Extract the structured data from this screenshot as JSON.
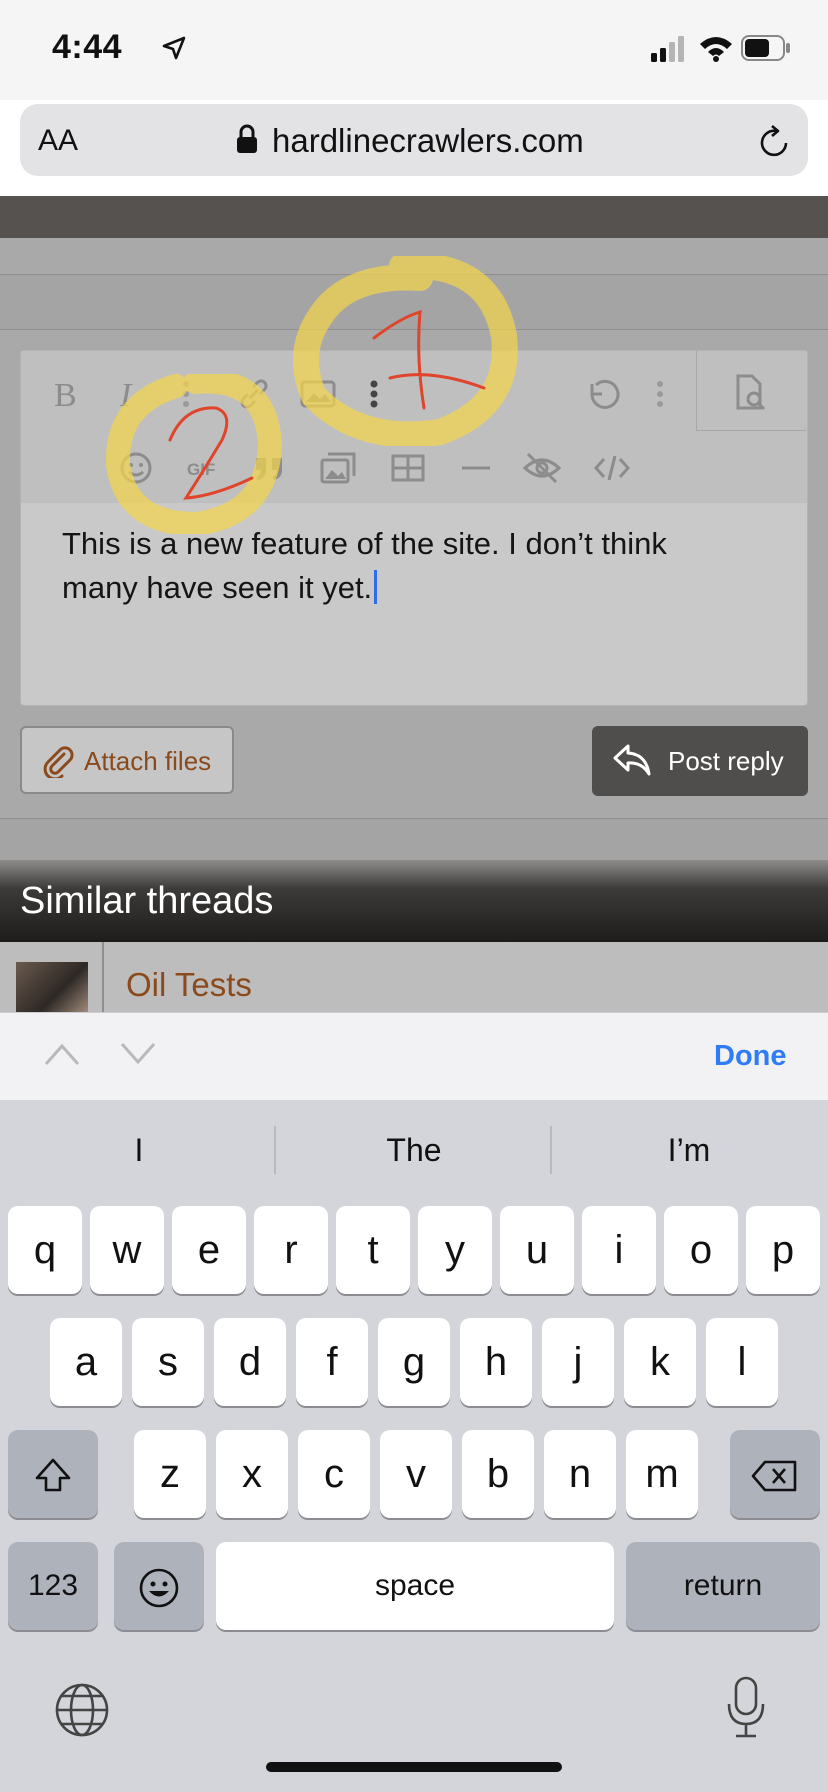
{
  "status_bar": {
    "time": "4:44"
  },
  "browser": {
    "text_size_label": "AA",
    "url": "hardlinecrawlers.com"
  },
  "editor": {
    "text": "This is a new feature of the site.  I don’t think many have seen it yet."
  },
  "buttons": {
    "attach_files": "Attach files",
    "post_reply": "Post reply"
  },
  "similar_threads": {
    "heading": "Similar threads",
    "items": [
      {
        "title": "Oil Tests"
      }
    ]
  },
  "keyboard": {
    "done_label": "Done",
    "suggestions": [
      "I",
      "The",
      "I’m"
    ],
    "row1": [
      "q",
      "w",
      "e",
      "r",
      "t",
      "y",
      "u",
      "i",
      "o",
      "p"
    ],
    "row2": [
      "a",
      "s",
      "d",
      "f",
      "g",
      "h",
      "j",
      "k",
      "l"
    ],
    "row3": [
      "z",
      "x",
      "c",
      "v",
      "b",
      "n",
      "m"
    ],
    "numbers_label": "123",
    "space_label": "space",
    "return_label": "return"
  },
  "annotations": {
    "mark_1": "1",
    "mark_2": "2",
    "highlight_color": "#f5d54a",
    "ink_color": "#e0442a"
  },
  "colors": {
    "link_brown": "#8a4a1c",
    "ios_blue": "#2f7cf6",
    "caret_blue": "#2c6ee8"
  }
}
